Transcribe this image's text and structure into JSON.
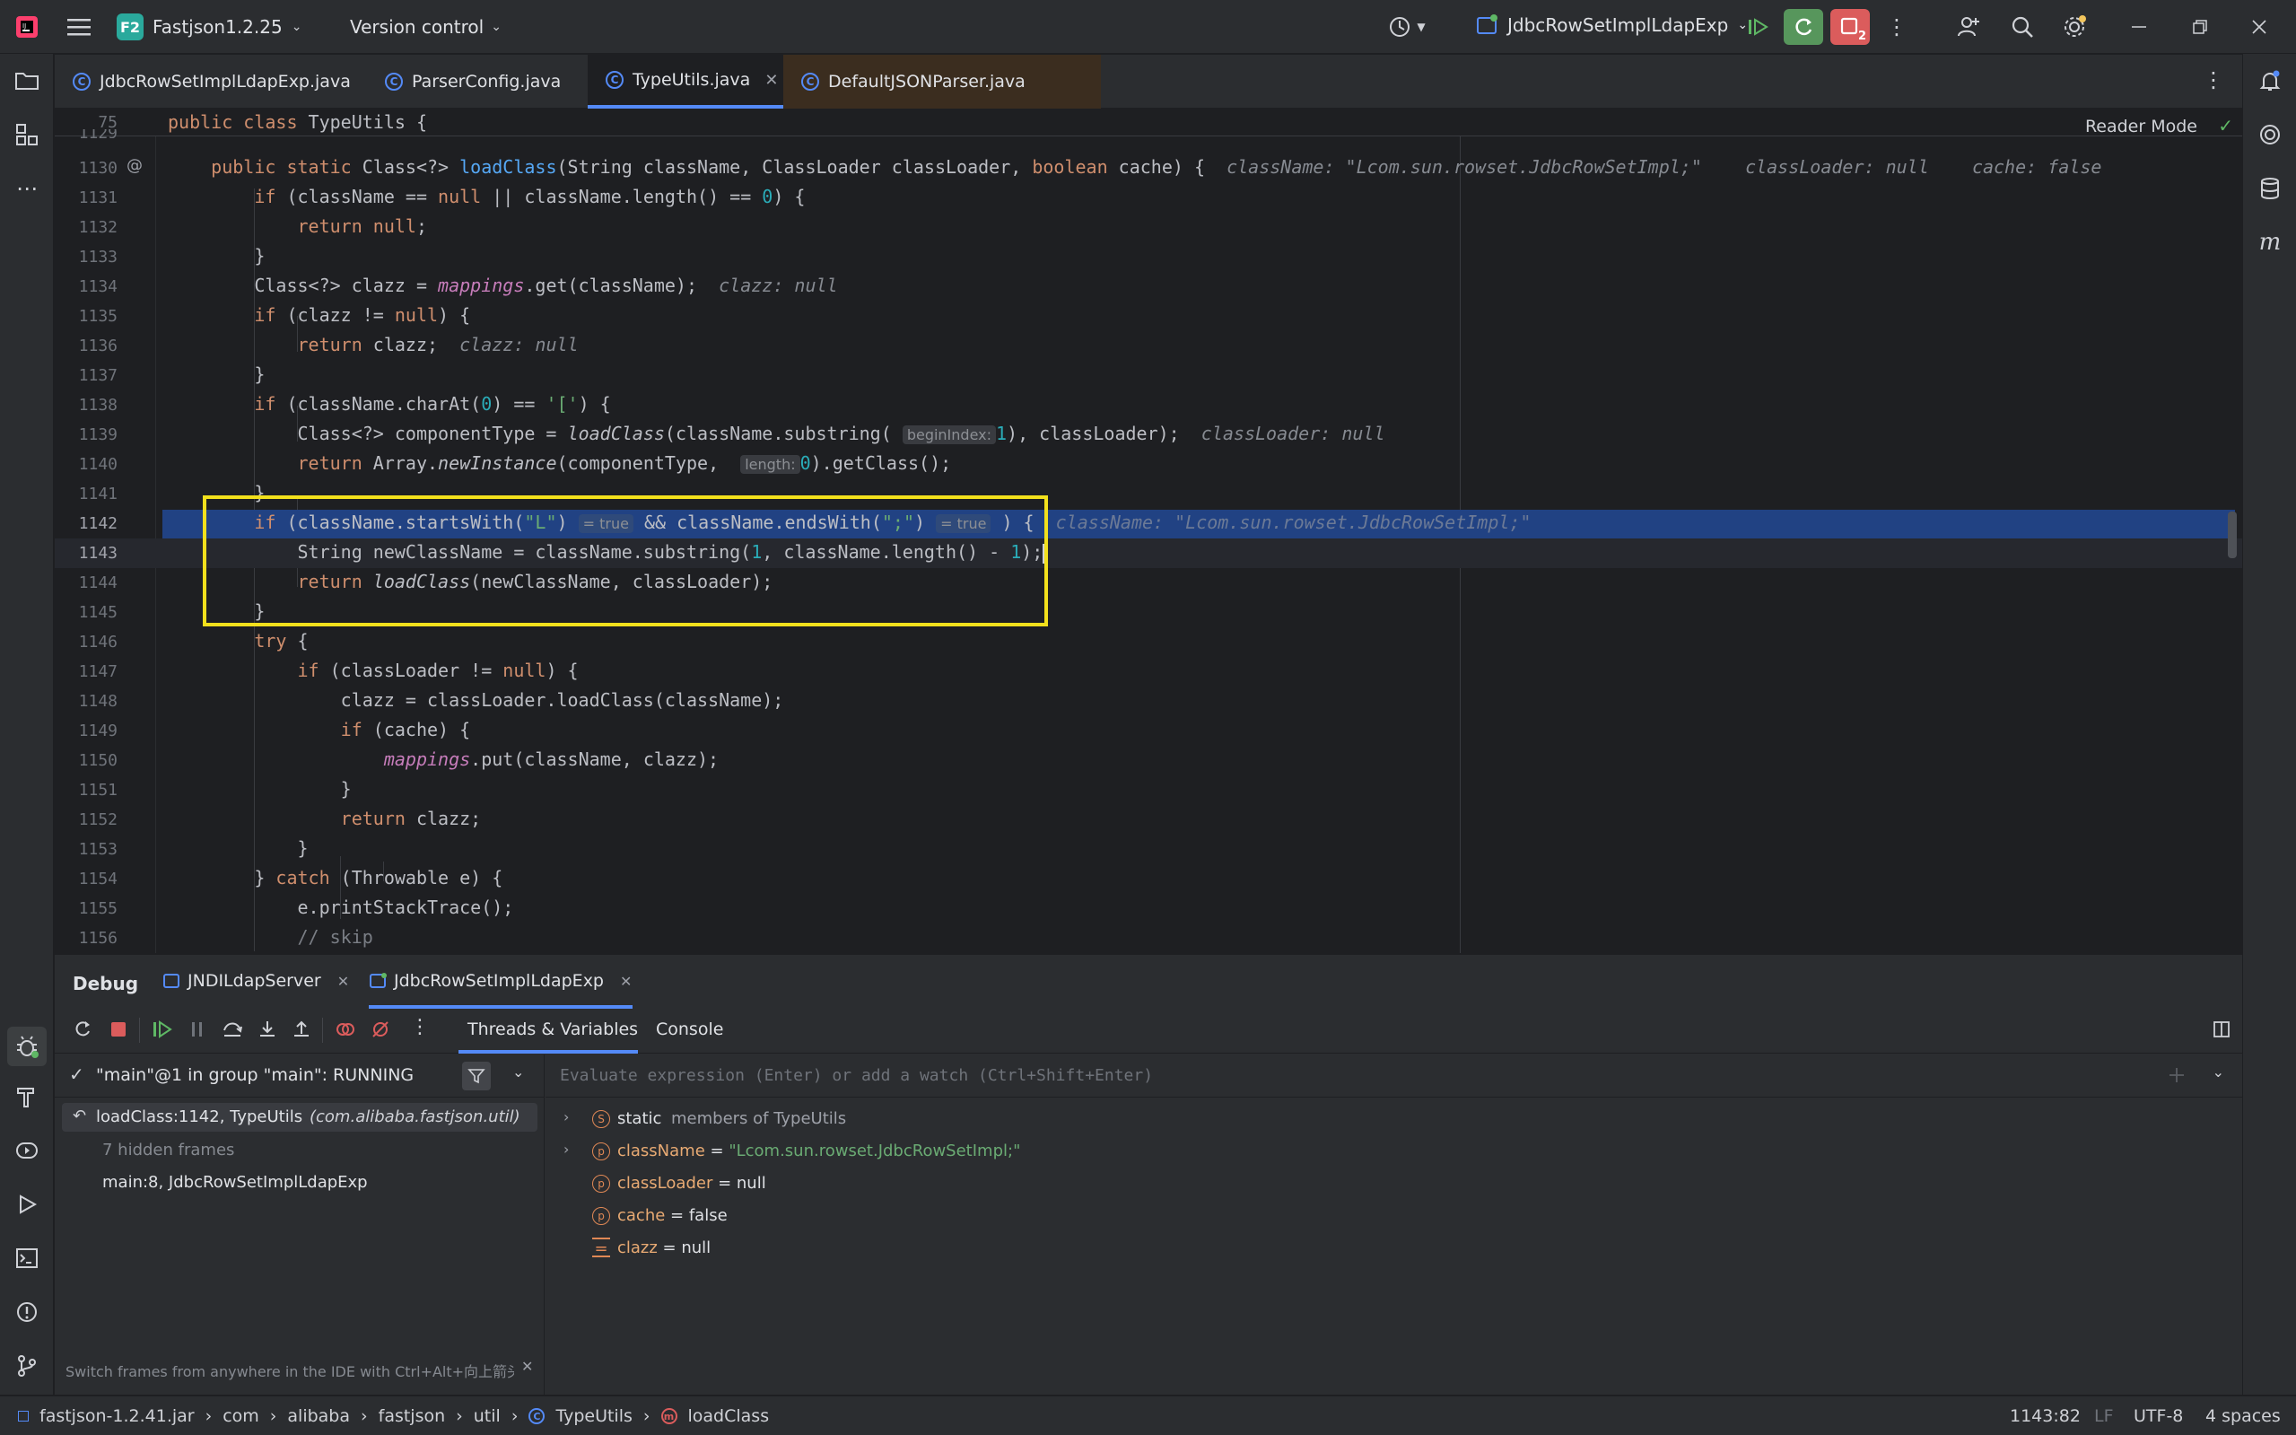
{
  "titlebar": {
    "project_badge": "F2",
    "project_name": "Fastjson1.2.25",
    "vcs_label": "Version control",
    "run_config": "JdbcRowSetImplLdapExp",
    "debug_badge": "2"
  },
  "tabs": [
    {
      "label": "JdbcRowSetImplLdapExp.java",
      "active": false
    },
    {
      "label": "ParserConfig.java",
      "active": false
    },
    {
      "label": "TypeUtils.java",
      "active": true
    },
    {
      "label": "DefaultJSONParser.java",
      "active": false
    }
  ],
  "editor": {
    "sticky_line_number": "75",
    "sticky_line": "public class TypeUtils {",
    "reader_mode": "Reader Mode",
    "partial_line_number": "1129",
    "lines": [
      {
        "n": "1130",
        "text": "public static Class<?> loadClass(String className, ClassLoader classLoader, boolean cache) {"
      },
      {
        "n": "1131",
        "text": "if (className == null || className.length() == 0) {"
      },
      {
        "n": "1132",
        "text": "return null;"
      },
      {
        "n": "1133",
        "text": "}"
      },
      {
        "n": "1134",
        "text": "Class<?> clazz = mappings.get(className);"
      },
      {
        "n": "1135",
        "text": "if (clazz != null) {"
      },
      {
        "n": "1136",
        "text": "return clazz;"
      },
      {
        "n": "1137",
        "text": "}"
      },
      {
        "n": "1138",
        "text": "if (className.charAt(0) == '[') {"
      },
      {
        "n": "1139",
        "text": "Class<?> componentType = loadClass(className.substring(1), classLoader);"
      },
      {
        "n": "1140",
        "text": "return Array.newInstance(componentType, 0).getClass();"
      },
      {
        "n": "1141",
        "text": "}"
      },
      {
        "n": "1142",
        "text": "if (className.startsWith(\"L\") && className.endsWith(\";\")) {"
      },
      {
        "n": "1143",
        "text": "String newClassName = className.substring(1, className.length() - 1);"
      },
      {
        "n": "1144",
        "text": "return loadClass(newClassName, classLoader);"
      },
      {
        "n": "1145",
        "text": "}"
      },
      {
        "n": "1146",
        "text": "try {"
      },
      {
        "n": "1147",
        "text": "if (classLoader != null) {"
      },
      {
        "n": "1148",
        "text": "clazz = classLoader.loadClass(className);"
      },
      {
        "n": "1149",
        "text": "if (cache) {"
      },
      {
        "n": "1150",
        "text": "mappings.put(className, clazz);"
      },
      {
        "n": "1151",
        "text": "}"
      },
      {
        "n": "1152",
        "text": "return clazz;"
      },
      {
        "n": "1153",
        "text": "}"
      },
      {
        "n": "1154",
        "text": "} catch (Throwable e) {"
      },
      {
        "n": "1155",
        "text": "e.printStackTrace();"
      },
      {
        "n": "1156",
        "text": "// skip"
      }
    ],
    "hints": {
      "h1130_a": "className: \"Lcom.sun.rowset.JdbcRowSetImpl;\"",
      "h1130_b": "classLoader: null",
      "h1130_c": "cache: false",
      "h1134": "clazz: null",
      "h1136": "clazz: null",
      "h1139": "classLoader: null",
      "h1142": "className: \"Lcom.sun.rowset.JdbcRowSetImpl;\"",
      "inlay_beginIndex": "beginIndex:",
      "inlay_length": "length:",
      "inlay_true_1": "= true",
      "inlay_true_2": "= true"
    }
  },
  "debug": {
    "title": "Debug",
    "sessions": [
      {
        "label": "JNDILdapServer"
      },
      {
        "label": "JdbcRowSetImplLdapExp"
      }
    ],
    "subtabs": [
      "Threads & Variables",
      "Console"
    ],
    "thread_label": "\"main\"@1 in group \"main\": RUNNING",
    "frames": [
      {
        "label": "loadClass:1142, TypeUtils",
        "pkg": "(com.alibaba.fastjson.util)"
      },
      {
        "label": "7 hidden frames"
      },
      {
        "label": "main:8, JdbcRowSetImplLdapExp"
      }
    ],
    "eval_placeholder": "Evaluate expression (Enter) or add a watch (Ctrl+Shift+Enter)",
    "variables": [
      {
        "badge": "S",
        "name": "static",
        "value": "members of TypeUtils"
      },
      {
        "badge": "p",
        "name": "className",
        "eq": " = ",
        "value": "\"Lcom.sun.rowset.JdbcRowSetImpl;\""
      },
      {
        "badge": "p",
        "name": "classLoader",
        "eq": " = ",
        "value": "null"
      },
      {
        "badge": "p",
        "name": "cache",
        "eq": " = ",
        "value": "false"
      },
      {
        "badge": "=",
        "name": "clazz",
        "eq": " = ",
        "value": "null"
      }
    ],
    "tip": "Switch frames from anywhere in the IDE with Ctrl+Alt+向上箭头..."
  },
  "statusbar": {
    "crumbs": [
      "fastjson-1.2.41.jar",
      "com",
      "alibaba",
      "fastjson",
      "util",
      "TypeUtils",
      "loadClass"
    ],
    "position": "1143:82",
    "line_sep": "LF",
    "encoding": "UTF-8",
    "indent": "4 spaces"
  },
  "colors": {
    "bg": "#1e1f22",
    "panel": "#2b2d30",
    "selection": "#214283",
    "highlight_box": "#f2e01c",
    "accent": "#548af7"
  }
}
